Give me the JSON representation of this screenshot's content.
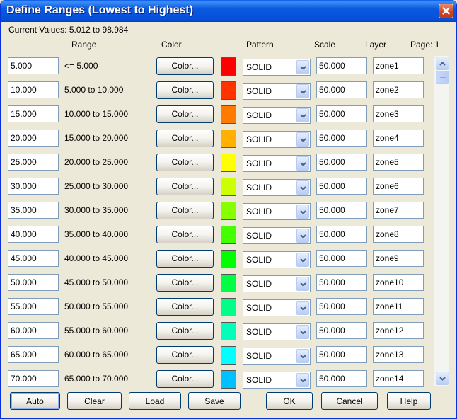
{
  "window": {
    "title": "Define Ranges (Lowest to Highest)",
    "close_icon": "close-icon"
  },
  "current_values": "Current Values: 5.012 to 98.984",
  "headers": {
    "range": "Range",
    "color": "Color",
    "pattern": "Pattern",
    "scale": "Scale",
    "layer": "Layer",
    "page": "Page: 1"
  },
  "rows": [
    {
      "value": "5.000",
      "range": "<= 5.000",
      "color_btn": "Color...",
      "color": "#ff0000",
      "pattern": "SOLID",
      "scale": "50.000",
      "layer": "zone1"
    },
    {
      "value": "10.000",
      "range": "5.000 to 10.000",
      "color_btn": "Color...",
      "color": "#ff3300",
      "pattern": "SOLID",
      "scale": "50.000",
      "layer": "zone2"
    },
    {
      "value": "15.000",
      "range": "10.000 to 15.000",
      "color_btn": "Color...",
      "color": "#ff7a00",
      "pattern": "SOLID",
      "scale": "50.000",
      "layer": "zone3"
    },
    {
      "value": "20.000",
      "range": "15.000 to 20.000",
      "color_btn": "Color...",
      "color": "#ffb000",
      "pattern": "SOLID",
      "scale": "50.000",
      "layer": "zone4"
    },
    {
      "value": "25.000",
      "range": "20.000 to 25.000",
      "color_btn": "Color...",
      "color": "#ffff00",
      "pattern": "SOLID",
      "scale": "50.000",
      "layer": "zone5"
    },
    {
      "value": "30.000",
      "range": "25.000 to 30.000",
      "color_btn": "Color...",
      "color": "#ccff00",
      "pattern": "SOLID",
      "scale": "50.000",
      "layer": "zone6"
    },
    {
      "value": "35.000",
      "range": "30.000 to 35.000",
      "color_btn": "Color...",
      "color": "#88ff00",
      "pattern": "SOLID",
      "scale": "50.000",
      "layer": "zone7"
    },
    {
      "value": "40.000",
      "range": "35.000 to 40.000",
      "color_btn": "Color...",
      "color": "#44ff00",
      "pattern": "SOLID",
      "scale": "50.000",
      "layer": "zone8"
    },
    {
      "value": "45.000",
      "range": "40.000 to 45.000",
      "color_btn": "Color...",
      "color": "#00ff00",
      "pattern": "SOLID",
      "scale": "50.000",
      "layer": "zone9"
    },
    {
      "value": "50.000",
      "range": "45.000 to 50.000",
      "color_btn": "Color...",
      "color": "#00ff44",
      "pattern": "SOLID",
      "scale": "50.000",
      "layer": "zone10"
    },
    {
      "value": "55.000",
      "range": "50.000 to 55.000",
      "color_btn": "Color...",
      "color": "#00ff88",
      "pattern": "SOLID",
      "scale": "50.000",
      "layer": "zone11"
    },
    {
      "value": "60.000",
      "range": "55.000 to 60.000",
      "color_btn": "Color...",
      "color": "#00ffbb",
      "pattern": "SOLID",
      "scale": "50.000",
      "layer": "zone12"
    },
    {
      "value": "65.000",
      "range": "60.000 to 65.000",
      "color_btn": "Color...",
      "color": "#00ffff",
      "pattern": "SOLID",
      "scale": "50.000",
      "layer": "zone13"
    },
    {
      "value": "70.000",
      "range": "65.000 to 70.000",
      "color_btn": "Color...",
      "color": "#00c0ff",
      "pattern": "SOLID",
      "scale": "50.000",
      "layer": "zone14"
    }
  ],
  "buttons": {
    "auto": "Auto",
    "clear": "Clear",
    "load": "Load",
    "save": "Save",
    "ok": "OK",
    "cancel": "Cancel",
    "help": "Help"
  }
}
